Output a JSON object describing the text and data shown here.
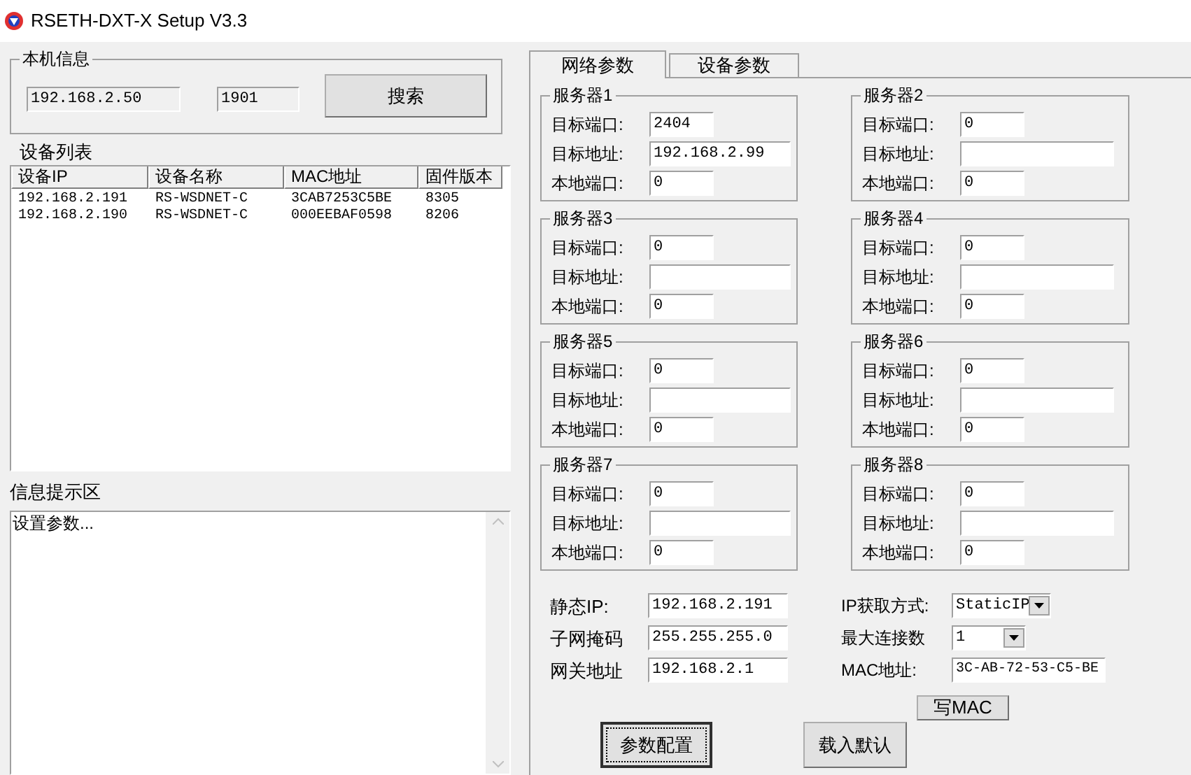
{
  "window": {
    "title": "RSETH-DXT-X Setup V3.3"
  },
  "local_info": {
    "title": "本机信息",
    "ip": "192.168.2.50",
    "port": "1901",
    "search_button": "搜索"
  },
  "device_list": {
    "title": "设备列表",
    "columns": [
      "设备IP",
      "设备名称",
      "MAC地址",
      "固件版本"
    ],
    "rows": [
      [
        "192.168.2.191",
        "RS-WSDNET-C",
        "3CAB7253C5BE",
        "8305"
      ],
      [
        "192.168.2.190",
        "RS-WSDNET-C",
        "000EEBAF0598",
        "8206"
      ]
    ]
  },
  "info_area": {
    "title": "信息提示区",
    "text": "设置参数..."
  },
  "tabs": [
    {
      "label": "网络参数",
      "selected": true
    },
    {
      "label": "设备参数",
      "selected": false
    }
  ],
  "servers": [
    {
      "title": "服务器1",
      "target_port_label": "目标端口:",
      "target_port": "2404",
      "target_address_label": "目标地址:",
      "target_address": "192.168.2.99",
      "local_port_label": "本地端口:",
      "local_port": "0"
    },
    {
      "title": "服务器2",
      "target_port_label": "目标端口:",
      "target_port": "0",
      "target_address_label": "目标地址:",
      "local_port_label": "本地端口:",
      "local_port": "0"
    },
    {
      "title": "服务器3",
      "target_port_label": "目标端口:",
      "target_port": "0",
      "target_address_label": "目标地址:",
      "local_port_label": "本地端口:",
      "local_port": "0"
    },
    {
      "title": "服务器4",
      "target_port_label": "目标端口:",
      "target_port": "0",
      "target_address_label": "目标地址:",
      "local_port_label": "本地端口:",
      "local_port": "0"
    },
    {
      "title": "服务器5",
      "target_port_label": "目标端口:",
      "target_port": "0",
      "target_address_label": "目标地址:",
      "local_port_label": "本地端口:",
      "local_port": "0"
    },
    {
      "title": "服务器6",
      "target_port_label": "目标端口:",
      "target_port": "0",
      "target_address_label": "目标地址:",
      "local_port_label": "本地端口:",
      "local_port": "0"
    },
    {
      "title": "服务器7",
      "target_port_label": "目标端口:",
      "target_port": "0",
      "target_address_label": "目标地址:",
      "local_port_label": "本地端口:",
      "local_port": "0"
    },
    {
      "title": "服务器8",
      "target_port_label": "目标端口:",
      "target_port": "0",
      "target_address_label": "目标地址:",
      "local_port_label": "本地端口:",
      "local_port": "0"
    }
  ],
  "network": {
    "left": [
      {
        "label": "静态IP:",
        "value": "192.168.2.191"
      },
      {
        "label": "子网掩码",
        "value": "255.255.255.0"
      },
      {
        "label": "网关地址",
        "value": "192.168.2.1"
      }
    ],
    "right": [
      {
        "label": "IP获取方式:",
        "value": "StaticIP",
        "kind": "select"
      },
      {
        "label": "最大连接数",
        "value": "1",
        "kind": "select"
      },
      {
        "label": "MAC地址:",
        "value": "3C-AB-72-53-C5-BE",
        "kind": "text"
      }
    ],
    "write_mac_button": "写MAC"
  },
  "buttons": [
    {
      "label": "参数配置",
      "focused": true
    },
    {
      "label": "载入默认",
      "focused": false
    }
  ]
}
